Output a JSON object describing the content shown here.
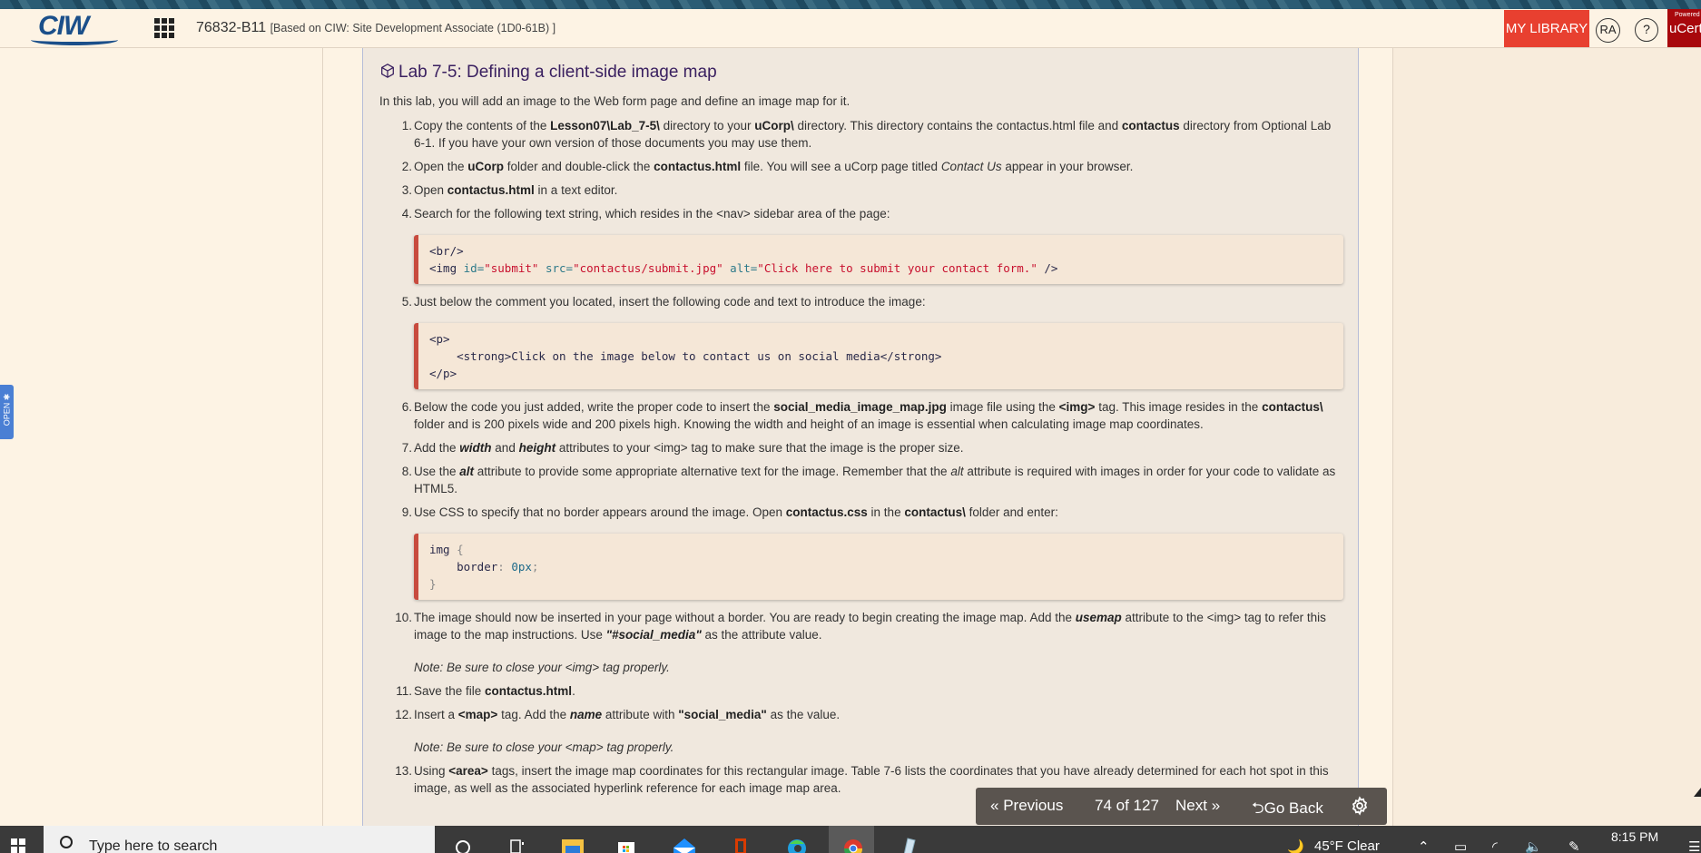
{
  "header": {
    "course_id": "76832-B11",
    "course_subtitle": "[Based on CIW: Site Development Associate (1D0-61B) ]",
    "logo_text": "CIW",
    "my_library": "MY LIBRARY",
    "avatar_initials": "RA",
    "help_label": "?",
    "brand_powered": "Powered by",
    "brand_name": "uCertify",
    "accent_color": "#e84030"
  },
  "side_tab": {
    "label": "OPEN ✱"
  },
  "lab": {
    "title": "Lab 7-5: Defining a client-side image map",
    "intro": "In this lab, you will add an image to the Web form page and define an image map for it.",
    "steps": [
      {
        "n": "1.",
        "parts": [
          {
            "t": "Copy the contents of the "
          },
          {
            "b": "Lesson07\\Lab_7-5\\"
          },
          {
            "t": " directory to your "
          },
          {
            "b": "uCorp\\"
          },
          {
            "t": " directory. This directory contains the contactus.html file and "
          },
          {
            "b": "contactus"
          },
          {
            "t": " directory from Optional Lab 6-1. If you have your own version of those documents you may use them."
          }
        ]
      },
      {
        "n": "2.",
        "parts": [
          {
            "t": "Open the "
          },
          {
            "b": "uCorp"
          },
          {
            "t": " folder and double-click the "
          },
          {
            "b": "contactus.html"
          },
          {
            "t": " file. You will see a uCorp page titled "
          },
          {
            "i": "Contact Us"
          },
          {
            "t": " appear in your browser."
          }
        ]
      },
      {
        "n": "3.",
        "parts": [
          {
            "t": "Open "
          },
          {
            "b": "contactus.html"
          },
          {
            "t": " in a text editor."
          }
        ]
      },
      {
        "n": "4.",
        "parts": [
          {
            "t": "Search for the following text string, which resides in the <nav> sidebar area of the page:"
          }
        ]
      },
      {
        "n": "5.",
        "parts": [
          {
            "t": "Just below the comment you located, insert the following code and text to introduce the image:"
          }
        ]
      },
      {
        "n": "6.",
        "parts": [
          {
            "t": "Below the code you just added, write the proper code to insert the "
          },
          {
            "b": "social_media_image_map.jpg"
          },
          {
            "t": " image file using the "
          },
          {
            "b": "<img>"
          },
          {
            "t": " tag. This image resides in the "
          },
          {
            "b": "contactus\\"
          },
          {
            "t": " folder and is 200 pixels wide and 200 pixels high. Knowing the width and height of an image is essential when calculating image map coordinates."
          }
        ]
      },
      {
        "n": "7.",
        "parts": [
          {
            "t": "Add the "
          },
          {
            "bi": "width"
          },
          {
            "t": " and "
          },
          {
            "bi": "height"
          },
          {
            "t": " attributes to your <img> tag to make sure that the image is the proper size."
          }
        ]
      },
      {
        "n": "8.",
        "parts": [
          {
            "t": "Use the "
          },
          {
            "bi": "alt"
          },
          {
            "t": " attribute to provide some appropriate alternative text for the image. Remember that the "
          },
          {
            "i": "alt"
          },
          {
            "t": " attribute is required with images in order for your code to validate as HTML5."
          }
        ]
      },
      {
        "n": "9.",
        "parts": [
          {
            "t": "Use CSS to specify that no border appears around the image. Open "
          },
          {
            "b": "contactus.css"
          },
          {
            "t": " in the "
          },
          {
            "b": "contactus\\"
          },
          {
            "t": " folder and enter:"
          }
        ]
      },
      {
        "n": "10.",
        "parts": [
          {
            "t": "The image should now be inserted in your page without a border. You are ready to begin creating the image map. Add the "
          },
          {
            "bi": "usemap"
          },
          {
            "t": " attribute to the <img> tag to refer this image to the map instructions. Use "
          },
          {
            "bi": "\"#social_media\""
          },
          {
            "t": " as the attribute value."
          }
        ],
        "note": "Note: Be sure to close your <img> tag properly."
      },
      {
        "n": "11.",
        "parts": [
          {
            "t": "Save the file "
          },
          {
            "b": "contactus.html"
          },
          {
            "t": "."
          }
        ]
      },
      {
        "n": "12.",
        "parts": [
          {
            "t": "Insert a "
          },
          {
            "b": "<map>"
          },
          {
            "t": " tag. Add the "
          },
          {
            "bi": "name"
          },
          {
            "t": " attribute with "
          },
          {
            "b": "\"social_media\""
          },
          {
            "t": " as the value."
          }
        ],
        "note": "Note: Be sure to close your <map> tag properly."
      },
      {
        "n": "13.",
        "parts": [
          {
            "t": "Using "
          },
          {
            "b": "<area>"
          },
          {
            "t": " tags, insert the image map coordinates for this rectangular image. Table 7-6 lists the coordinates that you have already determined for each hot spot in this image, as well as the associated hyperlink reference for each image map area."
          }
        ]
      }
    ],
    "code_blocks": {
      "after_step_4": [
        "<br/>",
        "<img id=\"submit\" src=\"contactus/submit.jpg\" alt=\"Click here to submit your contact form.\" />"
      ],
      "after_step_5": [
        "<p>",
        "    <strong>Click on the image below to contact us on social media</strong>",
        "</p>"
      ],
      "after_step_9": [
        "img {",
        "    border: 0px;",
        "}"
      ]
    }
  },
  "pager": {
    "previous": "Previous",
    "position": "74 of 127",
    "next": "Next",
    "go_back": "Go Back",
    "current_page": 74,
    "total_pages": 127
  },
  "taskbar": {
    "search_placeholder": "Type here to search",
    "weather": "45°F  Clear",
    "time": "8:15 PM"
  }
}
